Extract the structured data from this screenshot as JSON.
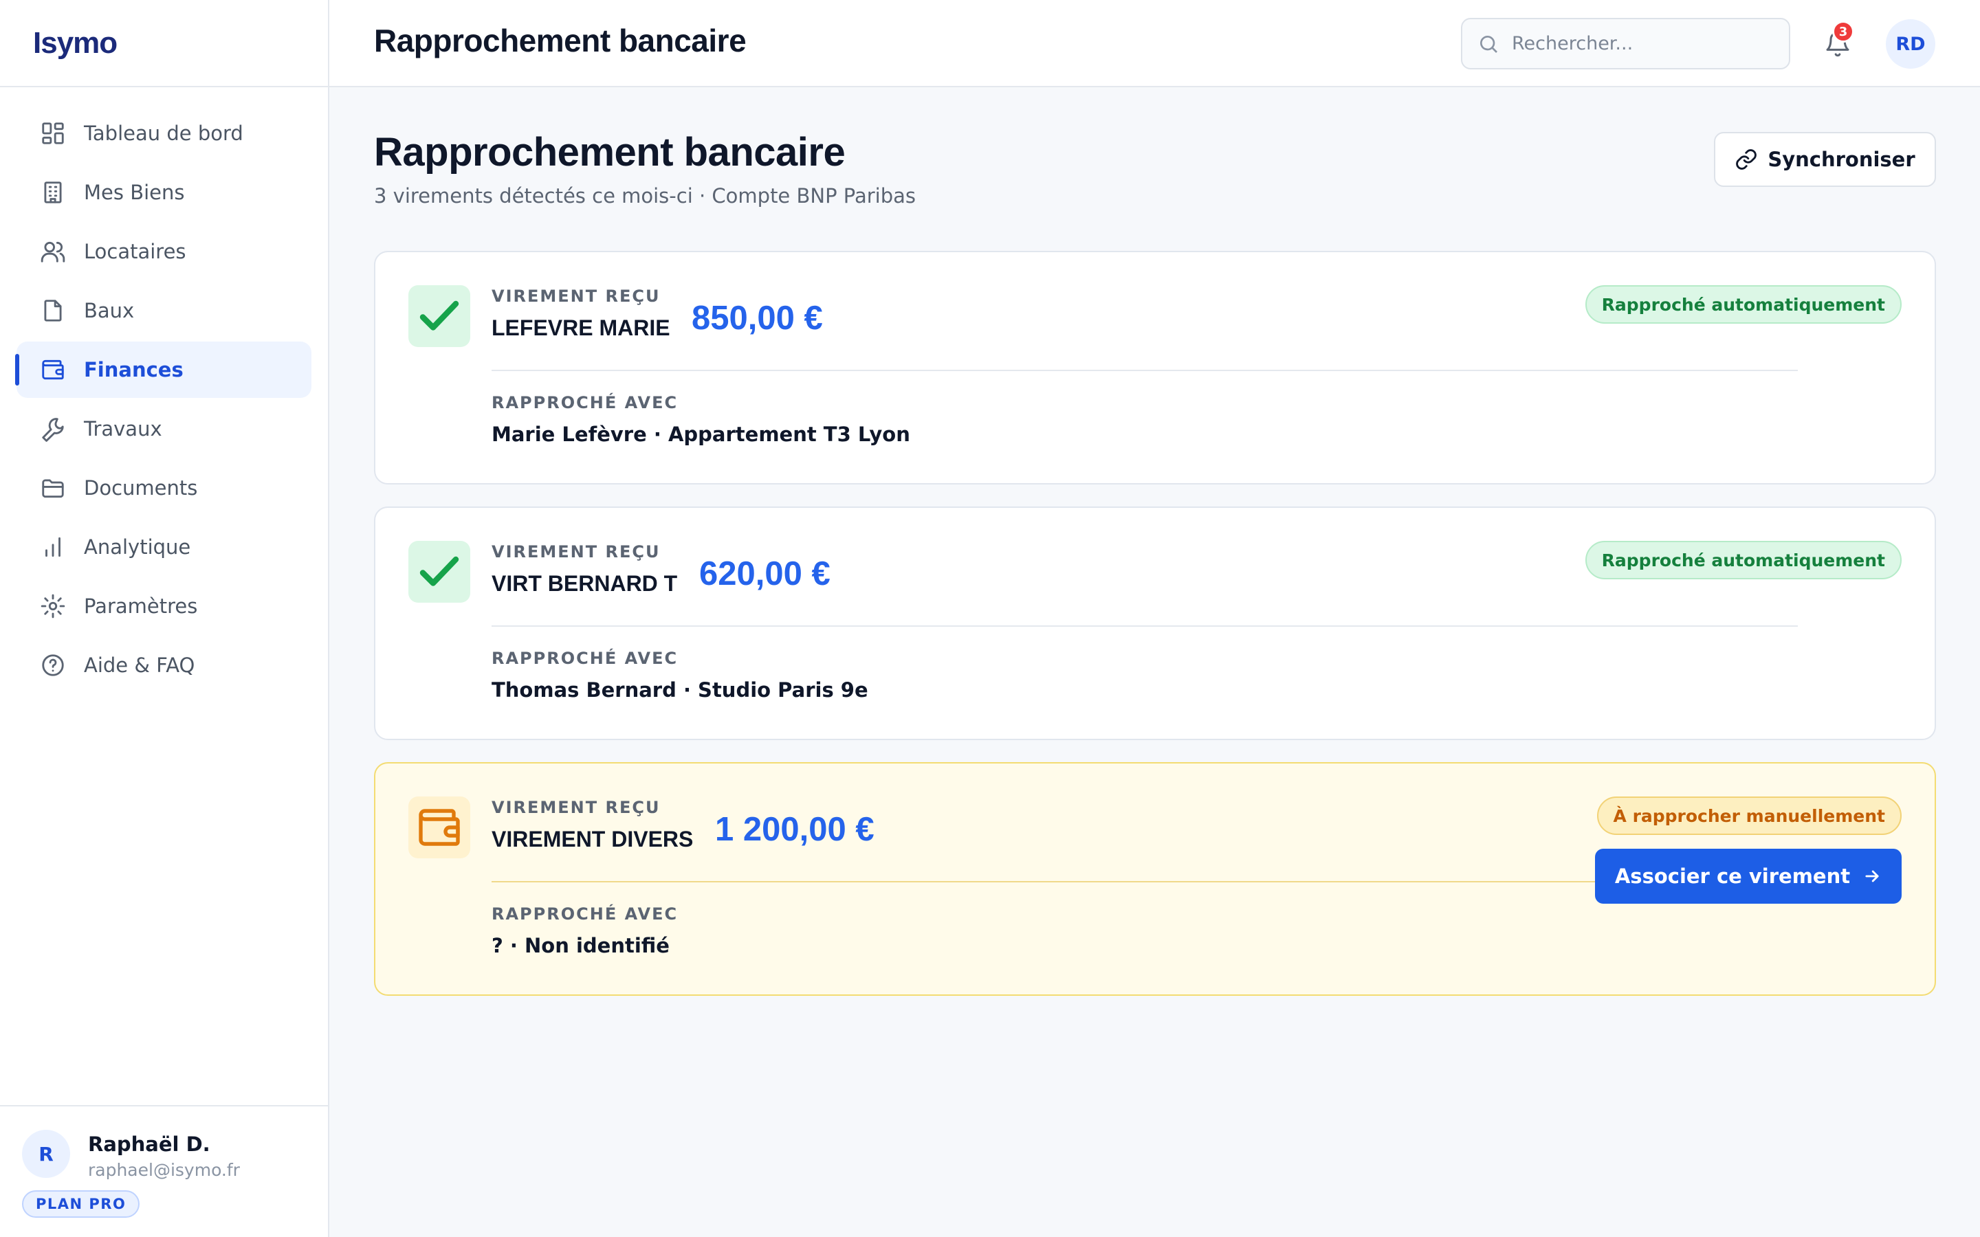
{
  "brand": "Isymo",
  "sidebar": {
    "items": [
      {
        "label": "Tableau de bord",
        "icon": "dashboard-icon"
      },
      {
        "label": "Mes Biens",
        "icon": "building-icon"
      },
      {
        "label": "Locataires",
        "icon": "users-icon"
      },
      {
        "label": "Baux",
        "icon": "file-icon"
      },
      {
        "label": "Finances",
        "icon": "wallet-icon",
        "active": true
      },
      {
        "label": "Travaux",
        "icon": "wrench-icon"
      },
      {
        "label": "Documents",
        "icon": "folder-icon"
      },
      {
        "label": "Analytique",
        "icon": "bar-chart-icon"
      },
      {
        "label": "Paramètres",
        "icon": "gear-icon"
      },
      {
        "label": "Aide & FAQ",
        "icon": "help-icon"
      }
    ],
    "user": {
      "initial": "R",
      "name": "Raphaël D.",
      "email": "raphael@isymo.fr",
      "plan": "PLAN PRO"
    }
  },
  "header": {
    "title": "Rapprochement bancaire",
    "search_placeholder": "Rechercher...",
    "notifications": "3",
    "avatar": "RD"
  },
  "main": {
    "heading": "Rapprochement bancaire",
    "subtitle": "3 virements détectés ce mois-ci · Compte BNP Paribas",
    "sync_label": "Synchroniser",
    "transfers": [
      {
        "kicker": "VIREMENT REÇU",
        "name": "LEFEVRE MARIE",
        "amount": "850,00 €",
        "match_label": "RAPPROCHÉ AVEC",
        "match": "Marie Lefèvre · Appartement T3 Lyon",
        "status": "Rapproché automatiquement"
      },
      {
        "kicker": "VIREMENT REÇU",
        "name": "VIRT BERNARD T",
        "amount": "620,00 €",
        "match_label": "RAPPROCHÉ AVEC",
        "match": "Thomas Bernard · Studio Paris 9e",
        "status": "Rapproché automatiquement"
      },
      {
        "kicker": "VIREMENT REÇU",
        "name": "VIREMENT DIVERS",
        "amount": "1 200,00 €",
        "match_label": "RAPPROCHÉ AVEC",
        "match": "? · Non identifié",
        "status": "À rapprocher manuellement",
        "action": "Associer ce virement"
      }
    ]
  },
  "colors": {
    "accent": "#1d4ed8",
    "amount": "#2563eb",
    "success": "#15803d",
    "warning": "#c25e06",
    "brand": "#1b2a7a"
  }
}
